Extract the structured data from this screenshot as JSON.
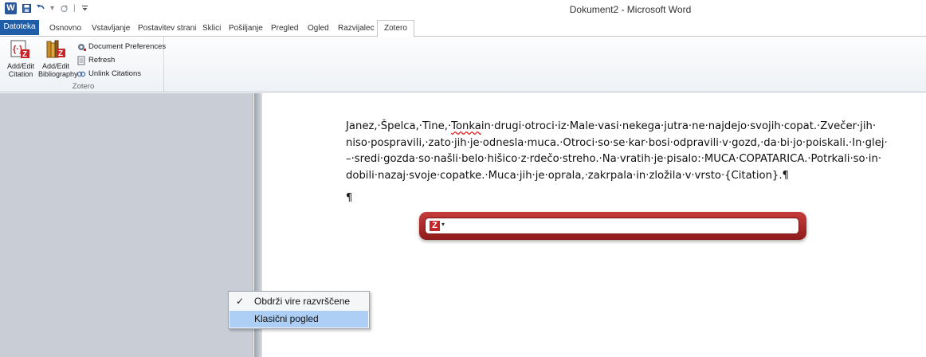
{
  "window": {
    "title": "Dokument2 - Microsoft Word"
  },
  "quick_access": {
    "app_icon": "W",
    "items": [
      "save-icon",
      "undo-icon",
      "redo-icon",
      "customize-icon"
    ]
  },
  "ribbon_tabs": [
    {
      "label": "Datoteka"
    },
    {
      "label": "Osnovno"
    },
    {
      "label": "Vstavljanje"
    },
    {
      "label": "Postavitev strani"
    },
    {
      "label": "Sklici"
    },
    {
      "label": "Pošiljanje"
    },
    {
      "label": "Pregled"
    },
    {
      "label": "Ogled"
    },
    {
      "label": "Razvijalec"
    },
    {
      "label": "Zotero"
    }
  ],
  "zotero_group": {
    "label": "Zotero",
    "add_edit_citation": "Add/Edit Citation",
    "add_edit_bibliography": "Add/Edit Bibliography",
    "document_preferences": "Document Preferences",
    "refresh": "Refresh",
    "unlink_citations": "Unlink Citations"
  },
  "document": {
    "lines": [
      "Janez,·Špelca,·Tine,·",
      "in·drugi·otroci·iz·Male·vasi·nekega·jutra·ne·najdejo·svojih·copat.·Zvečer·jih·",
      "niso·pospravili,·zato·jih·je·odnesla·muca.·Otroci·so·se·kar·bosi·odpravili·v·gozd,·da·bi·jo·poiskali.·In·glej·",
      "–·sredi·gozda·so·našli·belo·hišico·z·rdečo·streho.·Na·vratih·je·pisalo:·MUCA·COPATARICA.·Potrkali·so·in·",
      "dobili·nazaj·svoje·copatke.·Muca·jih·je·oprala,·zakrpala·in·zložila·v·vrsto·{Citation}.¶"
    ],
    "misspelled_word": "Tonka",
    "empty_paragraph": "¶"
  },
  "quick_format": {
    "icon": "Z",
    "input_value": "",
    "accent_color": "#b02a2a"
  },
  "context_menu": {
    "items": [
      {
        "label": "Obdrži vire razvrščene",
        "checked": true
      },
      {
        "label": "Klasični pogled",
        "highlighted": true
      }
    ]
  }
}
